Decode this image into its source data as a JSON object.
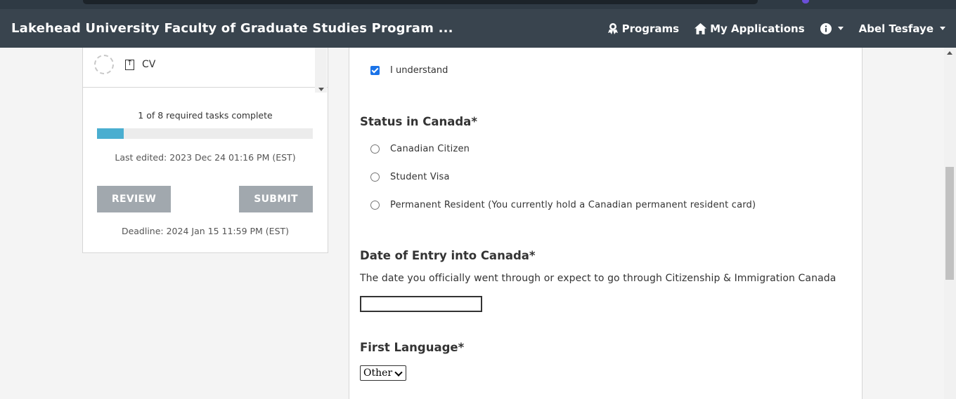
{
  "header": {
    "title": "Lakehead University Faculty of Graduate Studies Program ...",
    "nav": {
      "programs": "Programs",
      "my_applications": "My Applications",
      "user_name": "Abel Tesfaye"
    },
    "colors": {
      "background": "#39444e",
      "text": "#ffffff"
    }
  },
  "sidebar": {
    "task": {
      "label": "CV",
      "icon": "upload-icon",
      "status_icon": "incomplete-circle-icon"
    },
    "progress": {
      "text": "1 of 8 required tasks complete",
      "fraction": 0.125,
      "color": "#4aaed0"
    },
    "last_edited": "Last edited: 2023 Dec 24 01:16 PM (EST)",
    "review_label": "REVIEW",
    "submit_label": "SUBMIT",
    "deadline": "Deadline: 2024 Jan 15 11:59 PM (EST)"
  },
  "form": {
    "acknowledgement": {
      "label": "I understand",
      "checked": true
    },
    "status_section": {
      "title": "Status in Canada*",
      "options": [
        "Canadian Citizen",
        "Student Visa",
        "Permanent Resident (You currently hold a Canadian permanent resident card)"
      ]
    },
    "date_entry": {
      "title": "Date of Entry into Canada*",
      "help": "The date you officially went through or expect to go through Citizenship & Immigration Canada",
      "value": ""
    },
    "first_language": {
      "title": "First Language*",
      "selected": "Other"
    }
  }
}
